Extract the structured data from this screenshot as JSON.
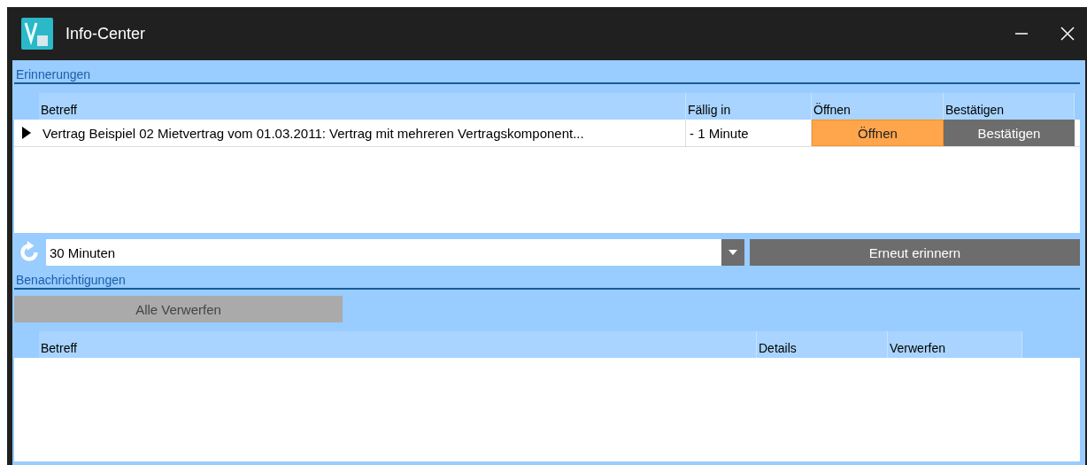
{
  "window": {
    "title": "Info-Center"
  },
  "reminders": {
    "heading": "Erinnerungen",
    "columns": [
      "Betreff",
      "Fällig in",
      "Öffnen",
      "Bestätigen"
    ],
    "rows": [
      {
        "selected": true,
        "subject": "Vertrag Beispiel 02 Mietvertrag vom 01.03.2011: Vertrag mit mehreren Vertragskomponent...",
        "due": "- 1 Minute",
        "open_button": "Öffnen",
        "confirm_button": "Bestätigen"
      }
    ]
  },
  "snooze": {
    "value": "30 Minuten",
    "button": "Erneut erinnern"
  },
  "notifications": {
    "heading": "Benachrichtigungen",
    "dismiss_all": {
      "label": "Alle Verwerfen",
      "disabled": true
    },
    "columns": [
      "Betreff",
      "Details",
      "Verwerfen"
    ]
  }
}
